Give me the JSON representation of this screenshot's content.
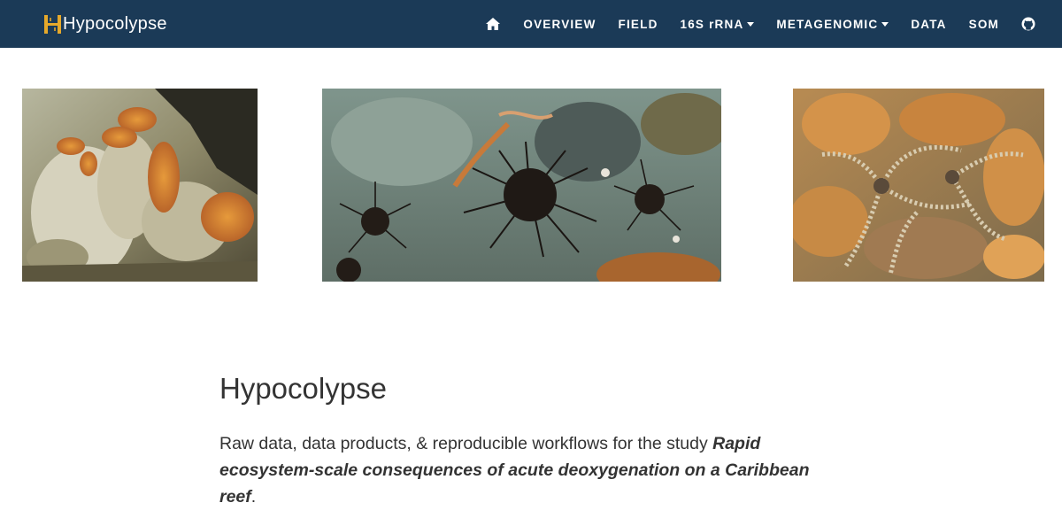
{
  "navbar": {
    "brand": "Hypocolypse",
    "brand_logo_letter": "H",
    "home_icon": "home-icon",
    "items": [
      {
        "label": "OVERVIEW",
        "dropdown": false
      },
      {
        "label": "FIELD",
        "dropdown": false
      },
      {
        "label": "16S rRNA",
        "dropdown": true
      },
      {
        "label": "METAGENOMIC",
        "dropdown": true
      },
      {
        "label": "DATA",
        "dropdown": false
      },
      {
        "label": "SOM",
        "dropdown": false
      }
    ],
    "github_icon": "github-icon",
    "colors": {
      "background": "#1b3a57",
      "text": "#ffffff",
      "logo_accent": "#e6a92b"
    }
  },
  "images": [
    {
      "name": "reef-photo-sponges"
    },
    {
      "name": "reef-photo-sea-urchins"
    },
    {
      "name": "reef-photo-brittle-stars"
    }
  ],
  "main": {
    "title": "Hypocolypse",
    "intro_prefix": "Raw data, data products, & reproducible workflows for the study ",
    "intro_emphasis": "Rapid ecosystem-scale consequences of acute deoxygenation on a Caribbean reef",
    "intro_suffix": "."
  }
}
